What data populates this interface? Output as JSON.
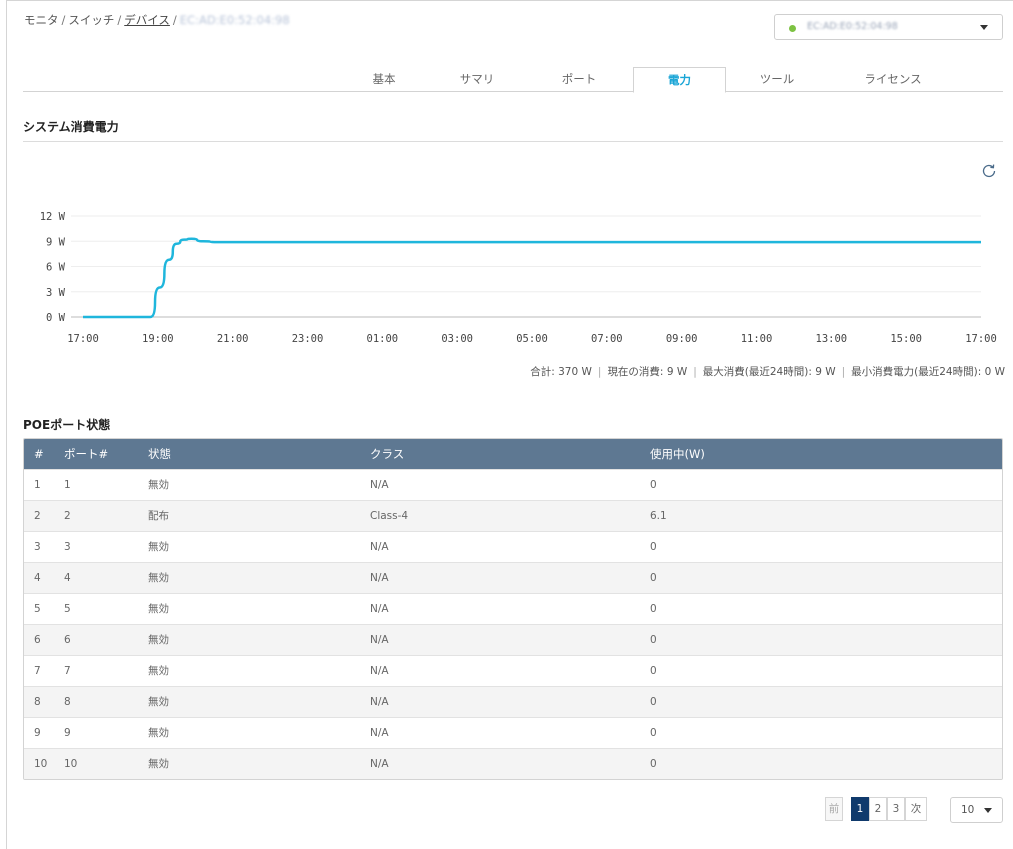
{
  "breadcrumb": {
    "items": [
      "モニタ",
      "スイッチ",
      "デバイス"
    ],
    "current": "EC:AD:E0:52:04:98"
  },
  "device_select": {
    "value": "EC:AD:E0:52:04:98",
    "status_color": "#7dc242"
  },
  "tabs": [
    {
      "label": "基本",
      "active": false
    },
    {
      "label": "サマリ",
      "active": false
    },
    {
      "label": "ポート",
      "active": false
    },
    {
      "label": "電力",
      "active": true
    },
    {
      "label": "ツール",
      "active": false
    },
    {
      "label": "ライセンス",
      "active": false
    }
  ],
  "power_section": {
    "title": "システム消費電力",
    "refresh_icon": "refresh-icon"
  },
  "chart_data": {
    "type": "line",
    "x": [
      "17:00",
      "19:00",
      "21:00",
      "23:00",
      "01:00",
      "03:00",
      "05:00",
      "07:00",
      "09:00",
      "11:00",
      "13:00",
      "15:00",
      "17:00"
    ],
    "yticks": [
      "0 W",
      "3 W",
      "6 W",
      "9 W",
      "12 W"
    ],
    "ylim": [
      0,
      12
    ],
    "series": [
      {
        "color": "#1fb6dc",
        "points": [
          [
            0,
            0
          ],
          [
            1.8,
            0
          ],
          [
            2.05,
            3.5
          ],
          [
            2.3,
            6.8
          ],
          [
            2.5,
            8.7
          ],
          [
            2.7,
            9.2
          ],
          [
            2.9,
            9.3
          ],
          [
            3.2,
            9.0
          ],
          [
            3.6,
            8.9
          ],
          [
            24,
            8.9
          ]
        ]
      }
    ],
    "grid": true,
    "legend": "none"
  },
  "stats": {
    "total": "合計: 370 W",
    "current": "現在の消費: 9 W",
    "max": "最大消費(最近24時間): 9 W",
    "min": "最小消費電力(最近24時間): 0 W"
  },
  "poe_section": {
    "title": "POEポート状態",
    "columns": [
      "#",
      "ポート#",
      "状態",
      "クラス",
      "使用中(W)"
    ],
    "rows": [
      [
        "1",
        "1",
        "無効",
        "N/A",
        "0"
      ],
      [
        "2",
        "2",
        "配布",
        "Class-4",
        "6.1"
      ],
      [
        "3",
        "3",
        "無効",
        "N/A",
        "0"
      ],
      [
        "4",
        "4",
        "無効",
        "N/A",
        "0"
      ],
      [
        "5",
        "5",
        "無効",
        "N/A",
        "0"
      ],
      [
        "6",
        "6",
        "無効",
        "N/A",
        "0"
      ],
      [
        "7",
        "7",
        "無効",
        "N/A",
        "0"
      ],
      [
        "8",
        "8",
        "無効",
        "N/A",
        "0"
      ],
      [
        "9",
        "9",
        "無効",
        "N/A",
        "0"
      ],
      [
        "10",
        "10",
        "無効",
        "N/A",
        "0"
      ]
    ]
  },
  "pagination": {
    "prev": "前",
    "pages": [
      "1",
      "2",
      "3"
    ],
    "current_page": "1",
    "next": "次",
    "page_size": "10"
  }
}
